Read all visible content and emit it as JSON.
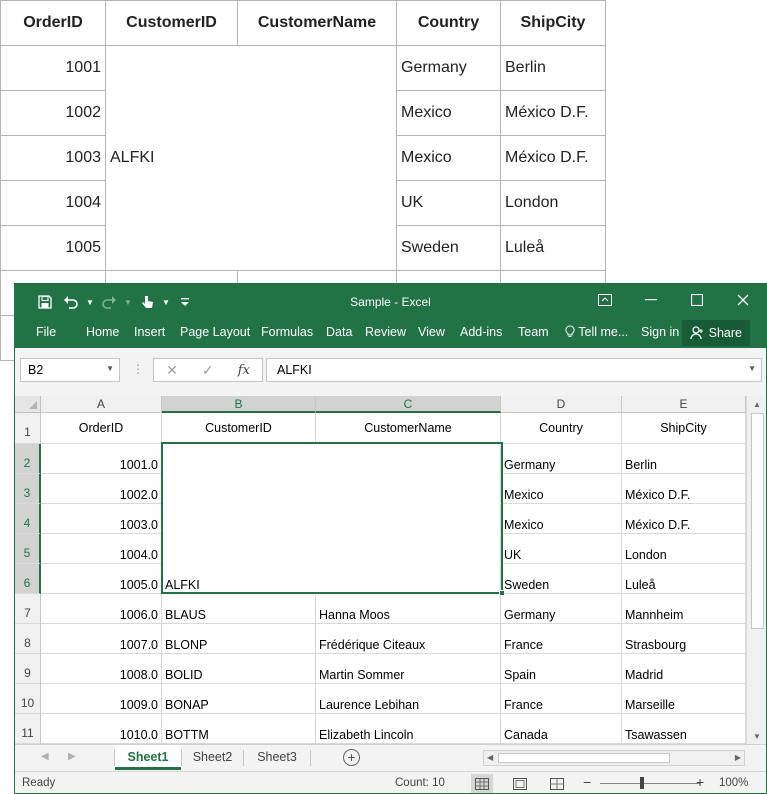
{
  "background_table": {
    "headers": [
      "OrderID",
      "CustomerID",
      "CustomerName",
      "Country",
      "ShipCity"
    ],
    "merged_customer_id": "ALFKI",
    "rows": [
      {
        "order_id": "1001",
        "country": "Germany",
        "ship_city": "Berlin"
      },
      {
        "order_id": "1002",
        "country": "Mexico",
        "ship_city": "México D.F."
      },
      {
        "order_id": "1003",
        "country": "Mexico",
        "ship_city": "México D.F."
      },
      {
        "order_id": "1004",
        "country": "UK",
        "ship_city": "London"
      },
      {
        "order_id": "1005",
        "country": "Sweden",
        "ship_city": "Luleå"
      }
    ]
  },
  "excel": {
    "title": "Sample - Excel",
    "tabs": [
      "File",
      "Home",
      "Insert",
      "Page Layout",
      "Formulas",
      "Data",
      "Review",
      "View",
      "Add-ins",
      "Team",
      "Tell me...",
      "Sign in"
    ],
    "share_label": "Share",
    "name_box": "B2",
    "formula_value": "ALFKI",
    "columns": [
      "A",
      "B",
      "C",
      "D",
      "E"
    ],
    "rows": [
      {
        "num": "1",
        "a": "OrderID",
        "b": "CustomerID",
        "c": "CustomerName",
        "d": "Country",
        "e": "ShipCity"
      },
      {
        "num": "2",
        "a": "1001.0",
        "b": "",
        "c": "",
        "d": "Germany",
        "e": "Berlin"
      },
      {
        "num": "3",
        "a": "1002.0",
        "b": "",
        "c": "",
        "d": "Mexico",
        "e": "México D.F."
      },
      {
        "num": "4",
        "a": "1003.0",
        "b": "",
        "c": "",
        "d": "Mexico",
        "e": "México D.F."
      },
      {
        "num": "5",
        "a": "1004.0",
        "b": "",
        "c": "",
        "d": "UK",
        "e": "London"
      },
      {
        "num": "6",
        "a": "1005.0",
        "b": "ALFKI",
        "c": "",
        "d": "Sweden",
        "e": "Luleå"
      },
      {
        "num": "7",
        "a": "1006.0",
        "b": "BLAUS",
        "c": "Hanna Moos",
        "d": "Germany",
        "e": "Mannheim"
      },
      {
        "num": "8",
        "a": "1007.0",
        "b": "BLONP",
        "c": "Frédérique Citeaux",
        "d": "France",
        "e": "Strasbourg"
      },
      {
        "num": "9",
        "a": "1008.0",
        "b": "BOLID",
        "c": "Martin Sommer",
        "d": "Spain",
        "e": "Madrid"
      },
      {
        "num": "10",
        "a": "1009.0",
        "b": "BONAP",
        "c": "Laurence Lebihan",
        "d": "France",
        "e": "Marseille"
      },
      {
        "num": "11",
        "a": "1010.0",
        "b": "BOTTM",
        "c": "Elizabeth Lincoln",
        "d": "Canada",
        "e": "Tsawassen"
      }
    ],
    "sheet_tabs": [
      "Sheet1",
      "Sheet2",
      "Sheet3"
    ],
    "active_sheet": "Sheet1",
    "status_ready": "Ready",
    "status_count": "Count: 10",
    "zoom": "100%",
    "accent_color": "#217346"
  }
}
